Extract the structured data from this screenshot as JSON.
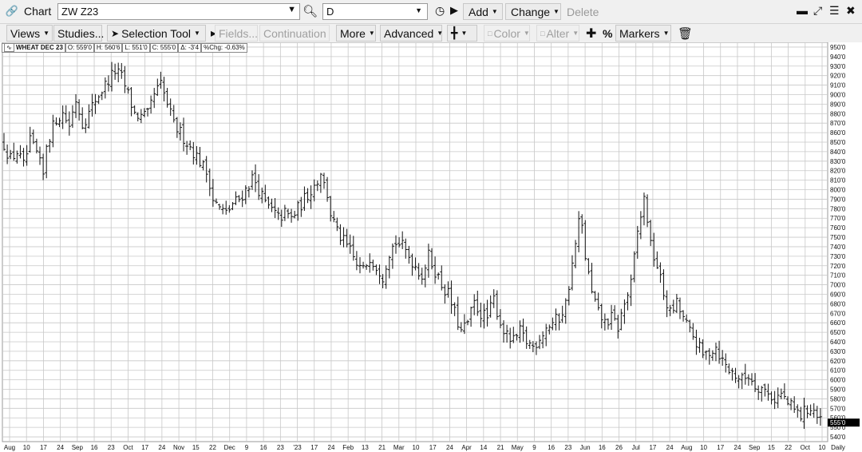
{
  "window": {
    "title": "Chart",
    "symbol": "ZW Z23",
    "interval": "D",
    "add_label": "Add",
    "change_label": "Change",
    "delete_label": "Delete"
  },
  "toolbar": {
    "views": "Views",
    "studies": "Studies...",
    "selection_tool": "Selection Tool",
    "fields": "Fields...",
    "continuation": "Continuation",
    "more": "More",
    "advanced": "Advanced",
    "color": "Color",
    "alter": "Alter",
    "percent": "%",
    "markers": "Markers"
  },
  "legend": {
    "title": "WHEAT DEC 23",
    "open": "O: 559'0",
    "high": "H: 560'6",
    "low": "L: 551'0",
    "close": "C: 555'0",
    "change": "Δ: -3'4",
    "pct_change": "%Chg: -0.63%"
  },
  "last_price_label": "555'0",
  "timeframe_label": "Daily",
  "chart_data": {
    "type": "bar",
    "style": "ohlc",
    "ylim": [
      535,
      955
    ],
    "y_ticks": [
      "950'0",
      "940'0",
      "930'0",
      "920'0",
      "910'0",
      "900'0",
      "890'0",
      "880'0",
      "870'0",
      "860'0",
      "850'0",
      "840'0",
      "830'0",
      "820'0",
      "810'0",
      "800'0",
      "790'0",
      "780'0",
      "770'0",
      "760'0",
      "750'0",
      "740'0",
      "730'0",
      "720'0",
      "710'0",
      "700'0",
      "690'0",
      "680'0",
      "670'0",
      "660'0",
      "650'0",
      "640'0",
      "630'0",
      "620'0",
      "610'0",
      "600'0",
      "590'0",
      "580'0",
      "570'0",
      "560'0",
      "550'0",
      "540'0"
    ],
    "x_ticks": [
      "Aug",
      "10",
      "17",
      "24",
      "Sep",
      "16",
      "23",
      "Oct",
      "17",
      "24",
      "Nov",
      "15",
      "22",
      "Dec",
      "9",
      "16",
      "23",
      "'23",
      "17",
      "24",
      "Feb",
      "13",
      "21",
      "Mar",
      "10",
      "17",
      "24",
      "Apr",
      "14",
      "21",
      "May",
      "9",
      "16",
      "23",
      "Jun",
      "16",
      "26",
      "Jul",
      "17",
      "24",
      "Aug",
      "10",
      "17",
      "24",
      "Sep",
      "15",
      "22",
      "Oct",
      "10"
    ],
    "close_path": [
      [
        0,
        848
      ],
      [
        2,
        832
      ],
      [
        4,
        840
      ],
      [
        6,
        825
      ],
      [
        8,
        850
      ],
      [
        10,
        838
      ],
      [
        12,
        815
      ],
      [
        13,
        848
      ],
      [
        16,
        875
      ],
      [
        18,
        880
      ],
      [
        20,
        868
      ],
      [
        22,
        895
      ],
      [
        24,
        870
      ],
      [
        26,
        880
      ],
      [
        28,
        895
      ],
      [
        30,
        905
      ],
      [
        34,
        925
      ],
      [
        36,
        918
      ],
      [
        38,
        900
      ],
      [
        40,
        880
      ],
      [
        42,
        876
      ],
      [
        44,
        878
      ],
      [
        46,
        900
      ],
      [
        48,
        910
      ],
      [
        50,
        890
      ],
      [
        52,
        868
      ],
      [
        54,
        860
      ],
      [
        56,
        850
      ],
      [
        58,
        840
      ],
      [
        60,
        830
      ],
      [
        62,
        818
      ],
      [
        63,
        808
      ],
      [
        64,
        790
      ],
      [
        66,
        780
      ],
      [
        68,
        775
      ],
      [
        70,
        785
      ],
      [
        72,
        790
      ],
      [
        74,
        800
      ],
      [
        76,
        812
      ],
      [
        77,
        808
      ],
      [
        80,
        785
      ],
      [
        82,
        778
      ],
      [
        84,
        770
      ],
      [
        86,
        775
      ],
      [
        88,
        770
      ],
      [
        90,
        780
      ],
      [
        92,
        790
      ],
      [
        94,
        800
      ],
      [
        96,
        810
      ],
      [
        97,
        820
      ],
      [
        98,
        805
      ],
      [
        99,
        795
      ],
      [
        100,
        775
      ],
      [
        102,
        755
      ],
      [
        104,
        745
      ],
      [
        106,
        735
      ],
      [
        108,
        720
      ],
      [
        110,
        715
      ],
      [
        112,
        730
      ],
      [
        114,
        720
      ],
      [
        116,
        710
      ],
      [
        118,
        735
      ],
      [
        120,
        745
      ],
      [
        122,
        740
      ],
      [
        124,
        730
      ],
      [
        126,
        720
      ],
      [
        128,
        710
      ],
      [
        130,
        730
      ],
      [
        132,
        715
      ],
      [
        134,
        700
      ],
      [
        136,
        690
      ],
      [
        138,
        670
      ],
      [
        140,
        650
      ],
      [
        142,
        660
      ],
      [
        144,
        680
      ],
      [
        146,
        670
      ],
      [
        148,
        665
      ],
      [
        150,
        685
      ],
      [
        152,
        660
      ],
      [
        154,
        645
      ],
      [
        156,
        640
      ],
      [
        158,
        650
      ],
      [
        160,
        640
      ],
      [
        162,
        635
      ],
      [
        164,
        645
      ],
      [
        166,
        655
      ],
      [
        168,
        660
      ],
      [
        170,
        665
      ],
      [
        172,
        680
      ],
      [
        174,
        720
      ],
      [
        176,
        765
      ],
      [
        177,
        760
      ],
      [
        178,
        730
      ],
      [
        180,
        690
      ],
      [
        182,
        670
      ],
      [
        184,
        660
      ],
      [
        186,
        665
      ],
      [
        188,
        655
      ],
      [
        190,
        680
      ],
      [
        192,
        700
      ],
      [
        194,
        755
      ],
      [
        196,
        790
      ],
      [
        197,
        770
      ],
      [
        198,
        740
      ],
      [
        200,
        720
      ],
      [
        202,
        690
      ],
      [
        204,
        670
      ],
      [
        206,
        680
      ],
      [
        208,
        665
      ],
      [
        210,
        650
      ],
      [
        212,
        640
      ],
      [
        214,
        625
      ],
      [
        216,
        630
      ],
      [
        218,
        635
      ],
      [
        220,
        620
      ],
      [
        222,
        610
      ],
      [
        224,
        605
      ],
      [
        226,
        600
      ],
      [
        228,
        605
      ],
      [
        230,
        595
      ],
      [
        232,
        592
      ],
      [
        234,
        585
      ],
      [
        236,
        580
      ],
      [
        238,
        585
      ],
      [
        240,
        575
      ],
      [
        242,
        568
      ],
      [
        243,
        565
      ],
      [
        244,
        562
      ],
      [
        246,
        570
      ],
      [
        248,
        568
      ],
      [
        249,
        560
      ],
      [
        250,
        555
      ]
    ]
  }
}
